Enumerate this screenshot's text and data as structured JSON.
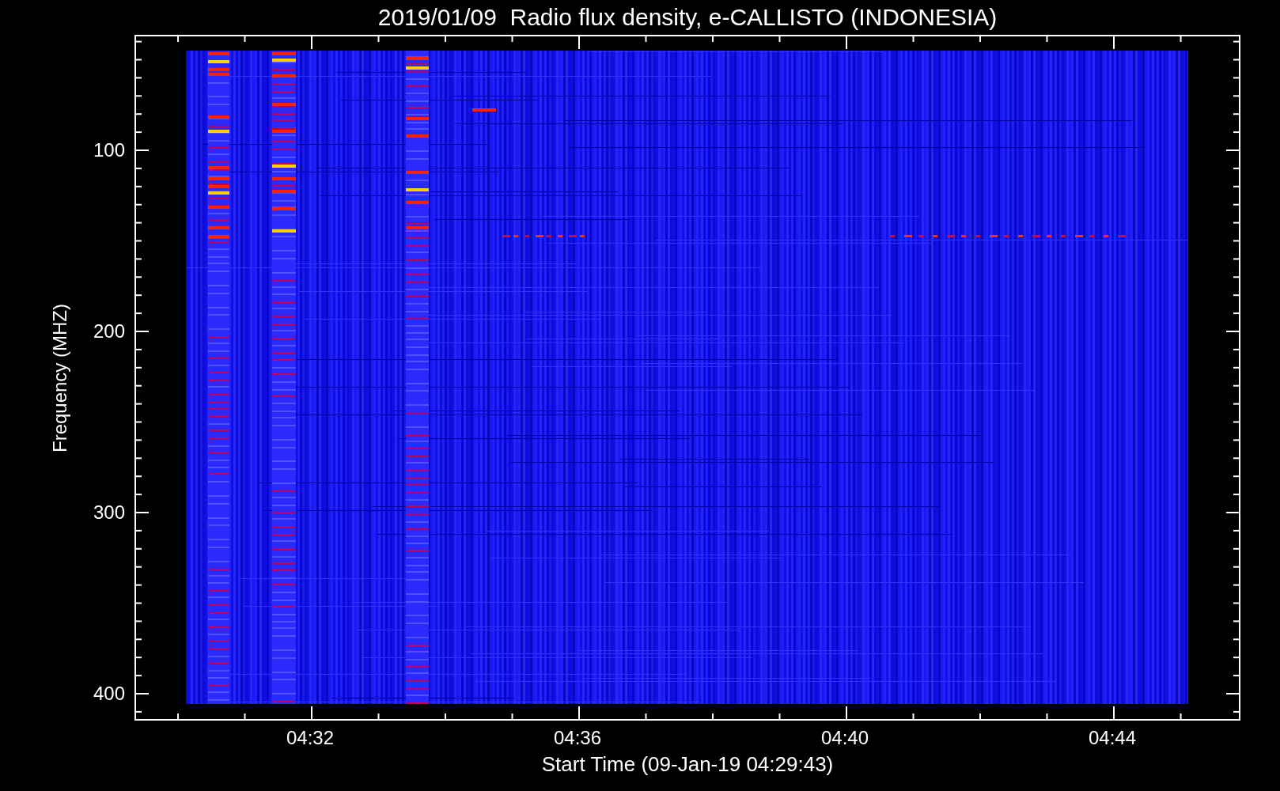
{
  "title": "2019/01/09  Radio flux density, e-CALLISTO (INDONESIA)",
  "y_axis": {
    "label": "Frequency (MHZ)",
    "ticks": [
      "100",
      "200",
      "300",
      "400"
    ]
  },
  "x_axis": {
    "label": "Start Time (09-Jan-19 04:29:43)",
    "ticks": [
      "04:32",
      "04:36",
      "04:40",
      "04:44"
    ]
  }
}
